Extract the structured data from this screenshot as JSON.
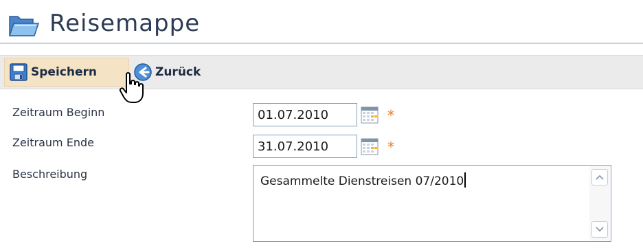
{
  "header": {
    "title": "Reisemappe",
    "icon": "open-folder-icon"
  },
  "toolbar": {
    "save_label": "Speichern",
    "save_icon": "save-disk-icon",
    "back_label": "Zurück",
    "back_icon": "back-arrow-icon"
  },
  "form": {
    "start": {
      "label": "Zeitraum Beginn",
      "value": "01.07.2010",
      "required_mark": "*"
    },
    "end": {
      "label": "Zeitraum Ende",
      "value": "31.07.2010",
      "required_mark": "*"
    },
    "description": {
      "label": "Beschreibung",
      "value": "Gesammelte Dienstreisen 07/2010"
    }
  },
  "colors": {
    "title": "#2d3c55",
    "required": "#f07b16",
    "toolbar_bg": "#ebebeb",
    "save_highlight": "#f5e3c6",
    "input_border": "#7f9db9"
  }
}
